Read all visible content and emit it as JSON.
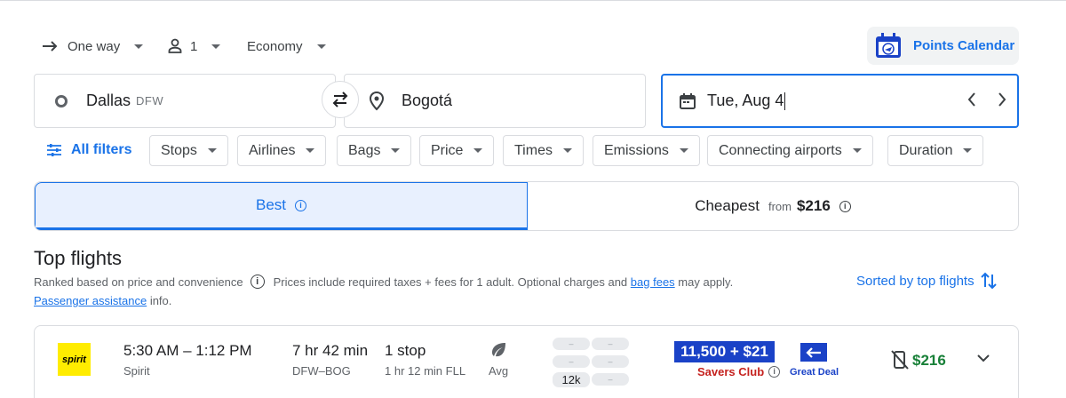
{
  "search": {
    "trip_type": "One way",
    "passengers": "1",
    "cabin": "Economy",
    "points_calendar": "Points Calendar",
    "origin": {
      "city": "Dallas",
      "code": "DFW"
    },
    "destination": {
      "city": "Bogotá"
    },
    "date": "Tue, Aug 4"
  },
  "filters": {
    "all_filters": "All filters",
    "chips": [
      "Stops",
      "Airlines",
      "Bags",
      "Price",
      "Times",
      "Emissions",
      "Connecting airports",
      "Duration"
    ]
  },
  "tabs": {
    "best": "Best",
    "cheapest": "Cheapest",
    "from": "from",
    "cheapest_price": "$216"
  },
  "results": {
    "heading": "Top flights",
    "ranked_text": "Ranked based on price and convenience",
    "prices_text": "Prices include required taxes + fees for 1 adult. Optional charges and",
    "bag_fees": "bag fees",
    "may_apply": "may apply.",
    "passenger_assistance": "Passenger assistance",
    "info": "info.",
    "sorted_by": "Sorted by top flights"
  },
  "flight": {
    "logo_text": "spirit",
    "times": "5:30 AM – 1:12 PM",
    "airline": "Spirit",
    "duration": "7 hr 42 min",
    "route": "DFW–BOG",
    "stops": "1 stop",
    "layover": "1 hr 12 min FLL",
    "emissions": "Avg",
    "pill_placeholder": "–",
    "pill_value": "12k",
    "savers_price": "11,500 + $21",
    "savers_label": "Savers Club",
    "deal_label": "Great Deal",
    "price": "$216"
  },
  "colors": {
    "accent": "#1a73e8",
    "savers_blue": "#1a42c7",
    "price_green": "#188038",
    "savers_red": "#c5221f",
    "spirit_yellow": "#ffec00"
  }
}
